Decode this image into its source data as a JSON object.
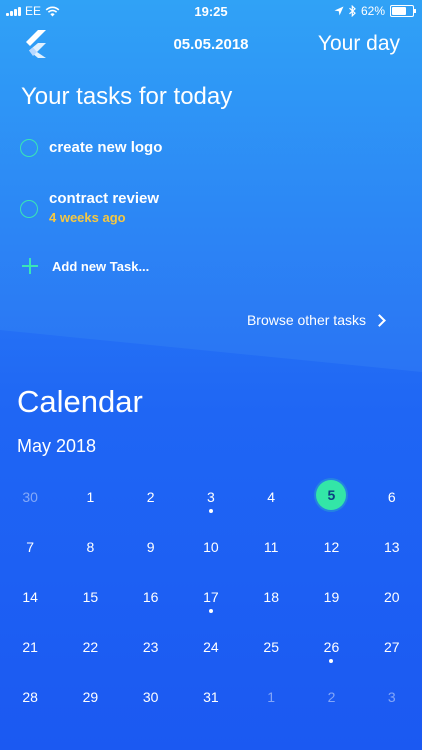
{
  "status_bar": {
    "carrier": "EE",
    "time": "19:25",
    "battery": "62%"
  },
  "header": {
    "date": "05.05.2018",
    "your_day": "Your day",
    "logo_icon": "flutter-logo-icon"
  },
  "tasks_section": {
    "title": "Your tasks for today",
    "tasks": [
      {
        "title": "create new logo",
        "subtitle": ""
      },
      {
        "title": "contract review",
        "subtitle": "4 weeks ago"
      }
    ],
    "add_task_label": "Add new Task...",
    "browse_label": "Browse other tasks"
  },
  "calendar": {
    "title": "Calendar",
    "month": "May 2018",
    "weeks": [
      [
        {
          "d": "30",
          "m": true
        },
        {
          "d": "1"
        },
        {
          "d": "2"
        },
        {
          "d": "3",
          "dot": true
        },
        {
          "d": "4"
        },
        {
          "d": "5",
          "today": true
        },
        {
          "d": "6"
        }
      ],
      [
        {
          "d": "7"
        },
        {
          "d": "8"
        },
        {
          "d": "9"
        },
        {
          "d": "10"
        },
        {
          "d": "11"
        },
        {
          "d": "12"
        },
        {
          "d": "13"
        }
      ],
      [
        {
          "d": "14"
        },
        {
          "d": "15"
        },
        {
          "d": "16"
        },
        {
          "d": "17",
          "dot": true
        },
        {
          "d": "18"
        },
        {
          "d": "19"
        },
        {
          "d": "20"
        }
      ],
      [
        {
          "d": "21"
        },
        {
          "d": "22"
        },
        {
          "d": "23"
        },
        {
          "d": "24"
        },
        {
          "d": "25"
        },
        {
          "d": "26",
          "dot": true
        },
        {
          "d": "27"
        }
      ],
      [
        {
          "d": "28"
        },
        {
          "d": "29"
        },
        {
          "d": "30"
        },
        {
          "d": "31"
        },
        {
          "d": "1",
          "m": true
        },
        {
          "d": "2",
          "m": true
        },
        {
          "d": "3",
          "m": true
        }
      ]
    ]
  },
  "colors": {
    "accent": "#33e6a7",
    "warning": "#f5c842",
    "bg_top": "#30a2f6",
    "bg_bottom": "#1b59f2"
  }
}
